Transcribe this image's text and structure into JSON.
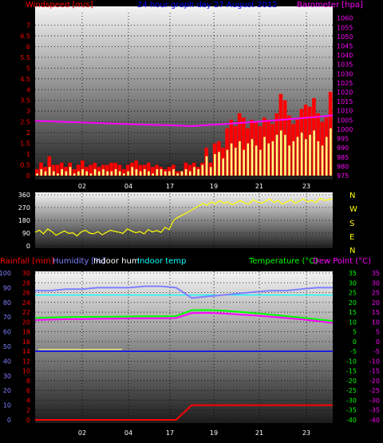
{
  "header_top": {
    "wind_label": "Windspeed [m/s]",
    "title": "24 hour graph day   27 August 2012",
    "baro_label": "Barometer [hpa]"
  },
  "header_bottom": {
    "rain_label": "Rainfall [mm]",
    "humidity_label": "Humidity [%]",
    "indoor_hum_label": "Indoor hum",
    "indoor_temp_label": "Indoor temp",
    "temp_label": "Temperature (°C)",
    "dew_label": "Dew Point (°C)"
  },
  "compass": {
    "labels": [
      "N",
      "W",
      "S",
      "E",
      "N"
    ]
  },
  "colors": {
    "wind": "#ff0000",
    "gust": "#ffff80",
    "baro": "#ff00ff",
    "dir": "#ffff00",
    "humidity": "#8080ff",
    "indoor_hum": "#ffffff",
    "indoor_temp": "#00ffff",
    "temp": "#00ff00",
    "dew": "#ff00ff",
    "rain": "#ff0000",
    "lo_line": "#0000ff"
  },
  "chart_data": [
    {
      "type": "line",
      "name": "wind_baro",
      "x_tick_labels": [
        "02",
        "04",
        "17",
        "19",
        "21",
        "23"
      ],
      "y_left_ticks": [
        "0",
        "0.5",
        "1",
        "1.5",
        "2",
        "2.5",
        "3",
        "3.5",
        "4",
        "4.5",
        "5",
        "5.5",
        "6",
        "6.5",
        "7"
      ],
      "y_left_range": [
        0,
        7.5
      ],
      "y_right_ticks": [
        "975",
        "980",
        "985",
        "990",
        "995",
        "1000",
        "1005",
        "1010",
        "1015",
        "1020",
        "1025",
        "1030",
        "1035",
        "1040",
        "1045",
        "1050",
        "1055",
        "1060"
      ],
      "y_right_range": [
        975,
        1062
      ],
      "series": [
        {
          "key": "wind",
          "values": [
            0.3,
            0.6,
            0.4,
            0.9,
            0.5,
            0.5,
            0.6,
            0.4,
            0.6,
            0.3,
            0.5,
            0.7,
            0.4,
            0.5,
            0.6,
            0.4,
            0.5,
            0.5,
            0.6,
            0.6,
            0.5,
            0.3,
            0.5,
            0.6,
            0.7,
            0.5,
            0.5,
            0.6,
            0.4,
            0.5,
            0.4,
            0.3,
            0.4,
            0.5,
            0.2,
            0.2,
            0.6,
            0.5,
            0.6,
            0.4,
            0.6,
            1.3,
            0.6,
            1.5,
            1.6,
            1.3,
            2.2,
            2.6,
            2.3,
            2.9,
            2.7,
            2.2,
            2.6,
            2.5,
            2.3,
            2.7,
            2.6,
            2.4,
            2.9,
            3.8,
            3.5,
            2.8,
            2.4,
            2.6,
            3.1,
            3.3,
            3.2,
            3.6,
            2.9,
            2.5,
            2.7,
            3.9
          ]
        },
        {
          "key": "gust",
          "values": [
            0.1,
            0.3,
            0.2,
            0.4,
            0.2,
            0.1,
            0.3,
            0.2,
            0.4,
            0.1,
            0.2,
            0.3,
            0.2,
            0.1,
            0.3,
            0.2,
            0.3,
            0.2,
            0.2,
            0.3,
            0.2,
            0.1,
            0.2,
            0.4,
            0.3,
            0.2,
            0.3,
            0.2,
            0.1,
            0.3,
            0.3,
            0.2,
            0.2,
            0.3,
            0.1,
            0.2,
            0.3,
            0.2,
            0.4,
            0.3,
            0.5,
            0.9,
            0.4,
            1.0,
            1.1,
            0.8,
            1.2,
            1.5,
            1.3,
            1.6,
            1.2,
            1.5,
            1.7,
            1.4,
            1.2,
            1.8,
            1.5,
            1.6,
            1.9,
            2.1,
            1.9,
            1.4,
            1.6,
            1.8,
            2.0,
            1.7,
            1.9,
            2.1,
            1.6,
            1.4,
            1.8,
            2.2
          ]
        },
        {
          "key": "baro",
          "values": [
            1004.5,
            1004.3,
            1004.0,
            1003.7,
            1003.4,
            1003.1,
            1002.8,
            1002.5,
            1002.3,
            1002.0,
            1001.7,
            1002.3,
            1002.8,
            1003.4,
            1004.0,
            1004.6,
            1005.3,
            1006.0,
            1006.7,
            1007.5
          ]
        }
      ]
    },
    {
      "type": "line",
      "name": "wind_direction",
      "x_tick_labels": [
        "02",
        "04",
        "17",
        "19",
        "21",
        "23"
      ],
      "y_ticks": [
        "0",
        "90",
        "180",
        "270",
        "360"
      ],
      "y_range": [
        0,
        360
      ],
      "series": [
        {
          "key": "dir",
          "values": [
            95,
            110,
            85,
            120,
            100,
            75,
            90,
            105,
            88,
            92,
            70,
            98,
            110,
            90,
            85,
            100,
            78,
            95,
            110,
            102,
            96,
            88,
            120,
            105,
            92,
            100,
            85,
            115,
            98,
            108,
            95,
            130,
            115,
            180,
            200,
            215,
            230,
            245,
            265,
            280,
            300,
            285,
            310,
            295,
            320,
            300,
            310,
            290,
            305,
            320,
            300,
            295,
            325,
            310,
            300,
            315,
            330,
            305,
            320,
            295,
            310,
            325,
            300,
            315,
            330,
            310,
            320,
            305,
            335,
            320,
            325,
            330
          ]
        }
      ]
    },
    {
      "type": "line",
      "name": "temp_humidity_rain",
      "x_tick_labels": [
        "02",
        "04",
        "17",
        "19",
        "21",
        "23"
      ],
      "y_left_ticks": [
        "0",
        "10",
        "20",
        "30",
        "40",
        "50",
        "60",
        "70",
        "80",
        "90",
        "100"
      ],
      "y_left_range": [
        0,
        100
      ],
      "y_rain_ticks": [
        "0",
        "2",
        "4",
        "6",
        "8",
        "10",
        "12",
        "14",
        "16",
        "18",
        "20",
        "22",
        "24",
        "26",
        "28",
        "30"
      ],
      "y_rain_range": [
        0,
        30
      ],
      "y_right_ticks": [
        "-40",
        "-35",
        "-30",
        "-25",
        "-20",
        "-15",
        "-10",
        "-5",
        "0",
        "5",
        "10",
        "15",
        "20",
        "25",
        "30",
        "35"
      ],
      "y_right_range": [
        -40,
        35
      ],
      "series": [
        {
          "key": "humidity",
          "values": [
            88,
            88,
            89,
            89,
            90,
            90,
            90,
            91,
            91,
            90,
            83,
            84,
            85,
            86,
            87,
            88,
            88,
            89,
            90,
            90
          ]
        },
        {
          "key": "indoor_temp",
          "values": [
            85,
            85,
            85,
            85,
            85,
            85,
            85,
            85,
            85,
            85,
            85,
            85,
            85,
            85,
            85,
            85,
            85,
            85,
            85,
            85
          ]
        },
        {
          "key": "temp",
          "values": [
            12,
            12.3,
            12.5,
            12.6,
            12.6,
            12.7,
            12.8,
            12.9,
            12.9,
            13,
            16,
            16.1,
            15.8,
            15.2,
            14.5,
            13.8,
            13,
            12.2,
            11.3,
            10.5
          ]
        },
        {
          "key": "dew",
          "values": [
            11,
            11.2,
            11.4,
            11.5,
            11.6,
            11.7,
            11.8,
            11.9,
            11.9,
            12,
            14.5,
            14.6,
            14.3,
            13.8,
            13.3,
            12.7,
            12,
            11.3,
            10.5,
            9.5
          ]
        },
        {
          "key": "indoor_hum",
          "values": [
            48,
            48,
            48,
            48,
            48,
            48,
            48
          ]
        },
        {
          "key": "low_line",
          "values": [
            -5,
            -5
          ]
        },
        {
          "key": "rain",
          "values": [
            0,
            0,
            0,
            0,
            0,
            0,
            0,
            0,
            0,
            0,
            3,
            3,
            3,
            3,
            3,
            3,
            3,
            3,
            3,
            3
          ]
        }
      ]
    }
  ]
}
